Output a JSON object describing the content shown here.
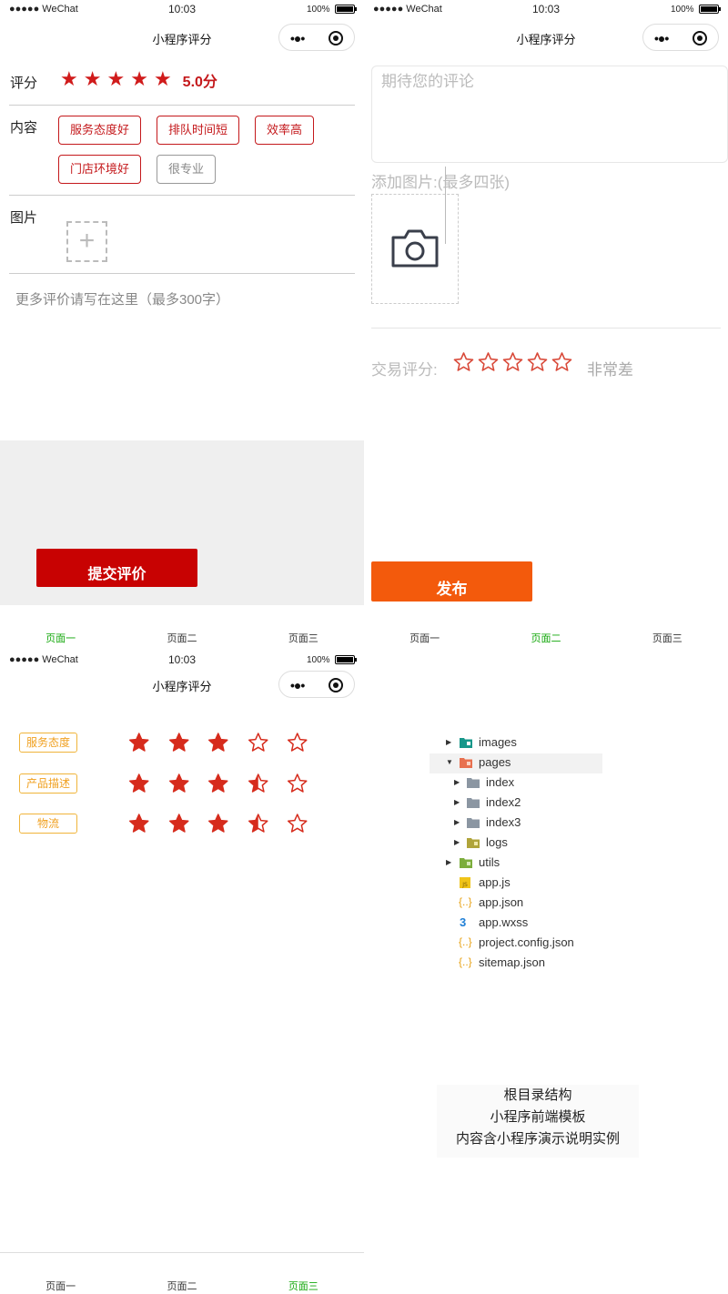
{
  "status_bar": {
    "carrier": "●●●●● WeChat",
    "time": "10:03",
    "battery": "100%"
  },
  "nav_title": "小程序评分",
  "colors": {
    "accent_red": "#c4181b",
    "orange": "#f35a0c",
    "tab_active_green": "#12a70a",
    "tag_orange": "#f0a020"
  },
  "panel1": {
    "rating_label": "评分",
    "rating_stars": 5,
    "score_text": "5.0分",
    "content_label": "内容",
    "tags": [
      {
        "label": "服务态度好",
        "selected": true
      },
      {
        "label": "排队时间短",
        "selected": true
      },
      {
        "label": "效率高",
        "selected": true
      },
      {
        "label": "门店环境好",
        "selected": true
      },
      {
        "label": "很专业",
        "selected": false
      }
    ],
    "image_label": "图片",
    "upload_icon": "plus-icon",
    "comment_placeholder": "更多评价请写在这里（最多300字）",
    "submit_label": "提交评价"
  },
  "panel2": {
    "comment_placeholder": "期待您的评论",
    "add_image_label": "添加图片:(最多四张)",
    "camera_icon": "camera-icon",
    "trade_label": "交易评分:",
    "trade_stars_filled": 0,
    "trade_rating_text": "非常差",
    "publish_label": "发布"
  },
  "tabbar_top": {
    "tabs": [
      {
        "label": "页面一",
        "active": true
      },
      {
        "label": "页面二",
        "active": false
      },
      {
        "label": "页面三",
        "active": false
      }
    ]
  },
  "tabbar_p4_top": {
    "tabs": [
      {
        "label": "页面一",
        "active": false
      },
      {
        "label": "页面二",
        "active": true
      },
      {
        "label": "页面三",
        "active": false
      }
    ]
  },
  "panel3": {
    "rows": [
      {
        "label": "服务态度",
        "value": 3
      },
      {
        "label": "产品描述",
        "value": 3.5
      },
      {
        "label": "物流",
        "value": 3.5
      }
    ]
  },
  "tabbar_bottom": {
    "tabs": [
      {
        "label": "页面一",
        "active": false
      },
      {
        "label": "页面二",
        "active": false
      },
      {
        "label": "页面三",
        "active": true
      }
    ]
  },
  "panel4": {
    "tree": [
      {
        "label": "images",
        "icon": "folder-images-icon",
        "expanded": false
      },
      {
        "label": "pages",
        "icon": "folder-pages-icon",
        "expanded": true
      },
      {
        "label": "index",
        "icon": "folder-icon",
        "expanded": false
      },
      {
        "label": "index2",
        "icon": "folder-icon",
        "expanded": false
      },
      {
        "label": "index3",
        "icon": "folder-icon",
        "expanded": false
      },
      {
        "label": "logs",
        "icon": "folder-logs-icon",
        "expanded": false
      },
      {
        "label": "utils",
        "icon": "folder-utils-icon",
        "expanded": false
      },
      {
        "label": "app.js",
        "icon": "js-file-icon"
      },
      {
        "label": "app.json",
        "icon": "json-file-icon"
      },
      {
        "label": "app.wxss",
        "icon": "css-file-icon"
      },
      {
        "label": "project.config.json",
        "icon": "json-file-icon"
      },
      {
        "label": "sitemap.json",
        "icon": "json-file-icon"
      }
    ],
    "note_lines": [
      "根目录结构",
      "小程序前端模板",
      "内容含小程序演示说明实例"
    ]
  }
}
